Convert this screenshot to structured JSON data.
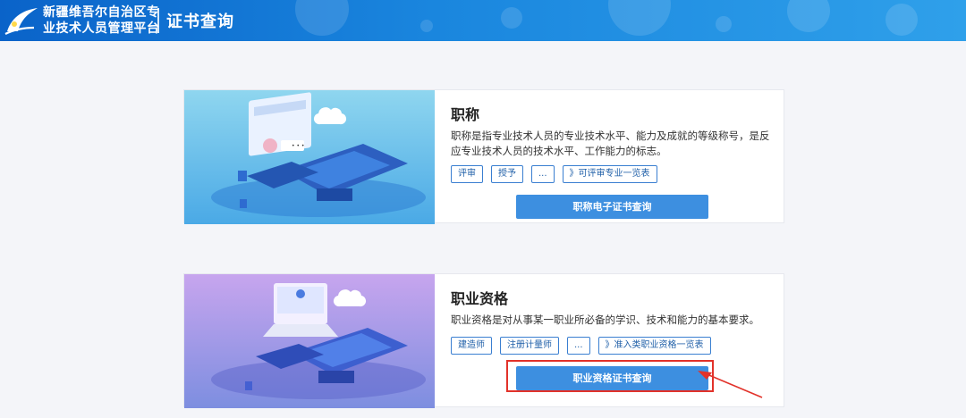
{
  "header": {
    "title_line1": "新疆维吾尔自治区专",
    "title_line2": "业技术人员管理平台",
    "page_title": "证书查询",
    "logo_icon": "platform-logo-icon",
    "gradient_start": "#0a63c9",
    "gradient_end": "#2fa0ea"
  },
  "cards": [
    {
      "title": "职称",
      "description": "职称是指专业技术人员的专业技术水平、能力及成就的等级称号，是反应专业技术人员的技术水平、工作能力的标志。",
      "tags": [
        "评审",
        "授予",
        "...",
        "》可评审专业一览表"
      ],
      "button_label": "职称电子证书查询",
      "illustration": "title-certificate-illustration"
    },
    {
      "title": "职业资格",
      "description": "职业资格是对从事某一职业所必备的学识、技术和能力的基本要求。",
      "tags": [
        "建造师",
        "注册计量师",
        "...",
        "》准入类职业资格一览表"
      ],
      "button_label": "职业资格证书查询",
      "illustration": "qualification-certificate-illustration"
    }
  ],
  "annotation": {
    "color": "#e2322a"
  },
  "accent_color": "#3d8fe0"
}
